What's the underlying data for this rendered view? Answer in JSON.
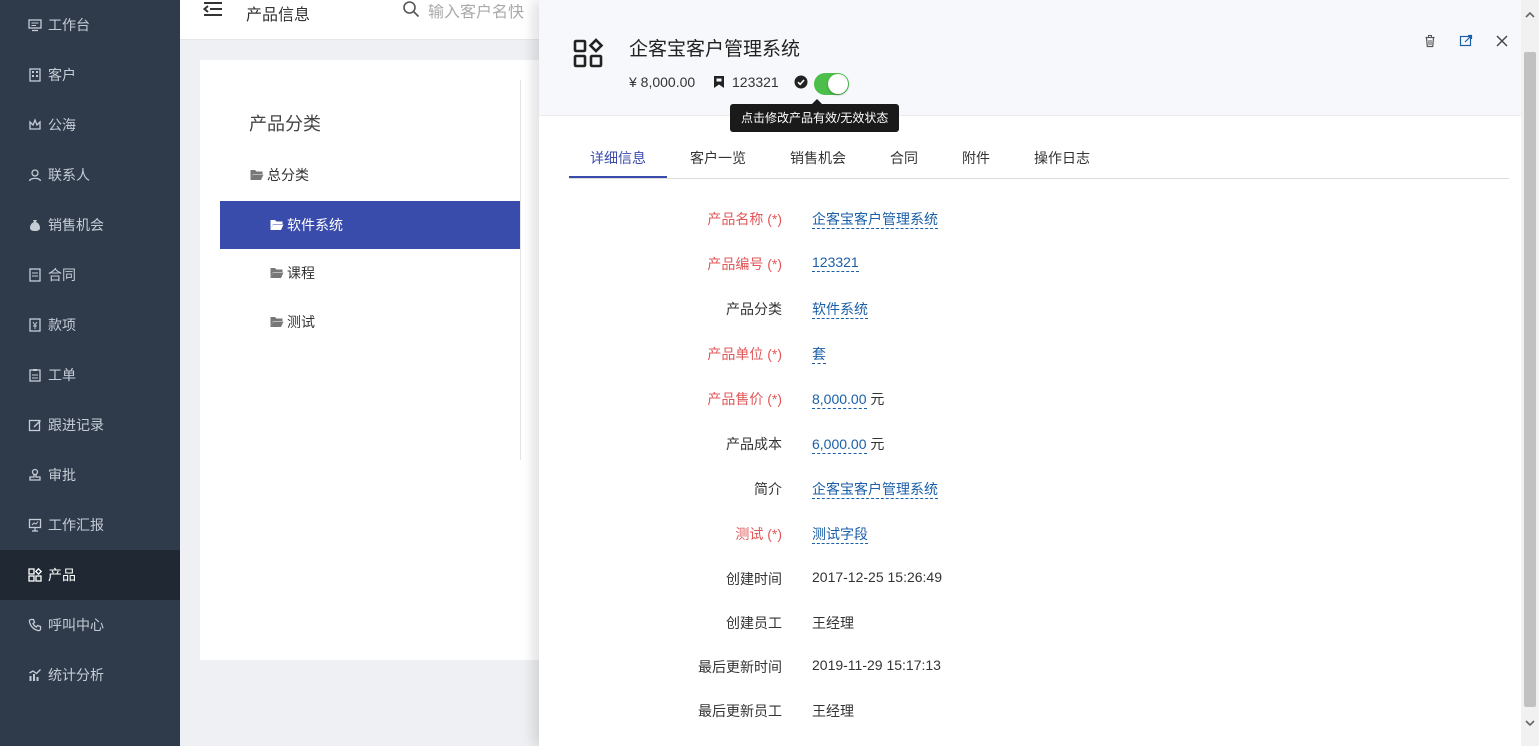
{
  "sidebar": {
    "items": [
      {
        "label": "工作台",
        "icon": "monitor-icon"
      },
      {
        "label": "客户",
        "icon": "building-icon"
      },
      {
        "label": "公海",
        "icon": "crown-icon"
      },
      {
        "label": "联系人",
        "icon": "user-icon"
      },
      {
        "label": "销售机会",
        "icon": "money-bag-icon"
      },
      {
        "label": "合同",
        "icon": "contract-icon"
      },
      {
        "label": "款项",
        "icon": "payment-icon"
      },
      {
        "label": "工单",
        "icon": "clipboard-icon"
      },
      {
        "label": "跟进记录",
        "icon": "edit-icon"
      },
      {
        "label": "审批",
        "icon": "stamp-icon"
      },
      {
        "label": "工作汇报",
        "icon": "presentation-icon"
      },
      {
        "label": "产品",
        "icon": "grid-icon",
        "active": true
      },
      {
        "label": "呼叫中心",
        "icon": "phone-icon"
      },
      {
        "label": "统计分析",
        "icon": "chart-icon"
      }
    ]
  },
  "topbar": {
    "title": "产品信息",
    "search_placeholder": "输入客户名快"
  },
  "categories": {
    "title": "产品分类",
    "items": [
      {
        "label": "总分类",
        "level": 0
      },
      {
        "label": "软件系统",
        "level": 1,
        "active": true
      },
      {
        "label": "课程",
        "level": 1
      },
      {
        "label": "测试",
        "level": 1
      }
    ]
  },
  "product": {
    "title": "企客宝客户管理系统",
    "price": "¥ 8,000.00",
    "code": "123321",
    "status_tooltip": "点击修改产品有效/无效状态",
    "active": true
  },
  "tabs": [
    "详细信息",
    "客户一览",
    "销售机会",
    "合同",
    "附件",
    "操作日志"
  ],
  "fields": [
    {
      "label": "产品名称 (*)",
      "value": "企客宝客户管理系统",
      "required": true,
      "editable": true,
      "suffix": ""
    },
    {
      "label": "产品编号 (*)",
      "value": "123321",
      "required": true,
      "editable": true,
      "suffix": ""
    },
    {
      "label": "产品分类",
      "value": "软件系统",
      "required": false,
      "editable": true,
      "suffix": ""
    },
    {
      "label": "产品单位 (*)",
      "value": "套",
      "required": true,
      "editable": true,
      "suffix": ""
    },
    {
      "label": "产品售价 (*)",
      "value": "8,000.00",
      "required": true,
      "editable": true,
      "suffix": " 元"
    },
    {
      "label": "产品成本",
      "value": "6,000.00",
      "required": false,
      "editable": true,
      "suffix": " 元"
    },
    {
      "label": "简介",
      "value": "企客宝客户管理系统",
      "required": false,
      "editable": true,
      "suffix": ""
    },
    {
      "label": "测试 (*)",
      "value": "测试字段",
      "required": true,
      "editable": true,
      "suffix": ""
    },
    {
      "label": "创建时间",
      "value": "2017-12-25 15:26:49",
      "required": false,
      "editable": false,
      "suffix": ""
    },
    {
      "label": "创建员工",
      "value": "王经理",
      "required": false,
      "editable": false,
      "suffix": ""
    },
    {
      "label": "最后更新时间",
      "value": "2019-11-29 15:17:13",
      "required": false,
      "editable": false,
      "suffix": ""
    },
    {
      "label": "最后更新员工",
      "value": "王经理",
      "required": false,
      "editable": false,
      "suffix": ""
    }
  ],
  "colors": {
    "sidebar_bg": "#2f3b4b",
    "accent": "#3a4cab",
    "required_label": "#e15758",
    "editable_link": "#1b5fa8",
    "toggle_on": "#4cbf4a"
  }
}
